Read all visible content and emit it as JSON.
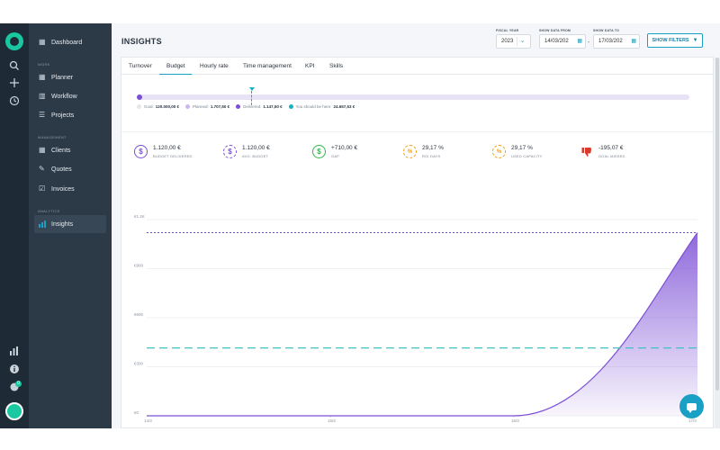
{
  "rail": {
    "icons": [
      "logo-icon",
      "search-icon",
      "plus-icon",
      "clock-icon",
      "bar-chart-icon",
      "info-icon",
      "puzzle-icon",
      "user-avatar"
    ],
    "notification_count": "0"
  },
  "sidebar": {
    "dashboard": "Dashboard",
    "section_work": "WORK",
    "planner": "Planner",
    "workflow": "Workflow",
    "projects": "Projects",
    "section_management": "MANAGEMENT",
    "clients": "Clients",
    "quotes": "Quotes",
    "invoices": "Invoices",
    "section_analytics": "ANALYTICS",
    "insights": "Insights"
  },
  "header": {
    "title": "INSIGHTS",
    "fiscal_year_label": "FISCAL YEAR",
    "fiscal_year_value": "2023",
    "from_label": "SHOW DATA FROM",
    "from_value": "14/03/202",
    "to_label": "SHOW DATA TO",
    "to_value": "17/03/202",
    "separator": "-",
    "filters_label": "SHOW FILTERS"
  },
  "tabs": [
    "Turnover",
    "Budget",
    "Hourly rate",
    "Time management",
    "KPI",
    "Skills"
  ],
  "active_tab": "Budget",
  "progress": {
    "goal_label": "Goal:",
    "goal_value": "120.000,00 €",
    "planned_label": "Planned:",
    "planned_value": "1.707,50 €",
    "delivered_label": "Delivered:",
    "delivered_value": "1.147,50 €",
    "should_label": "You should be here:",
    "should_value": "24.657,53 €",
    "colors": {
      "goal": "#e8e2f7",
      "planned": "#c9b8ef",
      "delivered": "#7c4fd6",
      "should": "#12b3c4"
    }
  },
  "kpis": [
    {
      "icon": "dollar-circle-icon",
      "value": "1.120,00 €",
      "label": "BUDGET DELIVERED",
      "color": "#7c4fd6"
    },
    {
      "icon": "dollar-dashed-circle-icon",
      "value": "1.120,00 €",
      "label": "AVG. BUDGET",
      "color": "#7c4fd6"
    },
    {
      "icon": "dollar-circle-icon",
      "value": "+710,00 €",
      "label": "GAP",
      "color": "#2fb84a"
    },
    {
      "icon": "percent-dashed-icon",
      "value": "29,17 %",
      "label": "ROI DAYS",
      "color": "#f39c12"
    },
    {
      "icon": "percent-dashed-icon",
      "value": "29,17 %",
      "label": "USED CAPACITY",
      "color": "#f39c12"
    },
    {
      "icon": "thumbs-down-icon",
      "value": "-195,07 €",
      "label": "GOAL MISSED",
      "color": "#d83a2e"
    }
  ],
  "chart_data": {
    "type": "area",
    "x": [
      "14/3",
      "15/3",
      "16/3",
      "17/3"
    ],
    "y_ticks": [
      "€0",
      "€300",
      "€600",
      "€900",
      "€1.2K"
    ],
    "ylim": [
      0,
      1200
    ],
    "series": [
      {
        "points": [
          [
            0,
            0
          ],
          [
            1,
            0
          ],
          [
            2,
            0
          ],
          [
            3,
            1120
          ]
        ],
        "color": "#7c4fd6",
        "fill": true
      }
    ],
    "reference_lines": [
      {
        "value": 1120,
        "style": "dotted",
        "color": "#6b4fc8"
      },
      {
        "value": 415,
        "style": "dashed",
        "color": "#3cc3c9"
      }
    ],
    "grid": true
  }
}
